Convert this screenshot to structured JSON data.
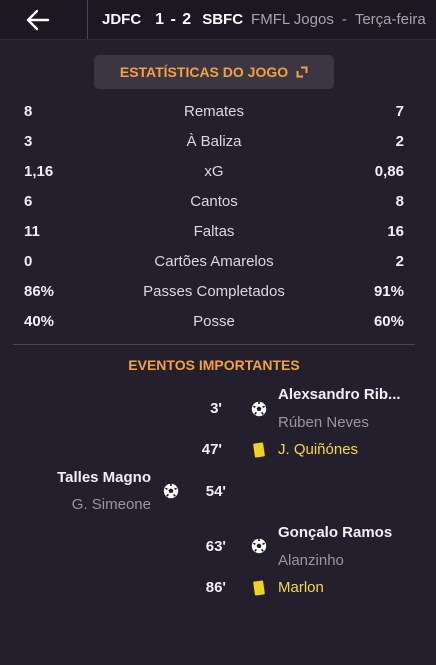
{
  "header": {
    "home_team": "JDFC",
    "score": "1 - 2",
    "away_team": "SBFC",
    "competition": "FMFL Jogos",
    "separator": "-",
    "day": "Terça-feira"
  },
  "stats_button": {
    "label": "ESTATÍSTICAS DO JOGO"
  },
  "stats": [
    {
      "label": "Remates",
      "home": "8",
      "away": "7"
    },
    {
      "label": "À Baliza",
      "home": "3",
      "away": "2"
    },
    {
      "label": "xG",
      "home": "1,16",
      "away": "0,86"
    },
    {
      "label": "Cantos",
      "home": "6",
      "away": "8"
    },
    {
      "label": "Faltas",
      "home": "11",
      "away": "16"
    },
    {
      "label": "Cartões Amarelos",
      "home": "0",
      "away": "2"
    },
    {
      "label": "Passes Completados",
      "home": "86%",
      "away": "91%"
    },
    {
      "label": "Posse",
      "home": "40%",
      "away": "60%"
    }
  ],
  "events_title": "EVENTOS IMPORTANTES",
  "events": [
    {
      "minute": "3'",
      "side": "away",
      "type": "goal",
      "player": "Alexsandro Rib...",
      "assist": "Rúben Neves"
    },
    {
      "minute": "47'",
      "side": "away",
      "type": "yellow-card",
      "player": "J. Quiñónes"
    },
    {
      "minute": "54'",
      "side": "home",
      "type": "goal",
      "player": "Talles Magno",
      "assist": "G. Simeone"
    },
    {
      "minute": "63'",
      "side": "away",
      "type": "goal",
      "player": "Gonçalo Ramos",
      "assist": "Alanzinho"
    },
    {
      "minute": "86'",
      "side": "away",
      "type": "yellow-card",
      "player": "Marlon"
    }
  ],
  "colors": {
    "background": "#241f2c",
    "accent": "#f4a23c",
    "yellow_card": "#f2d21a",
    "card_player_text": "#f2d94c"
  }
}
